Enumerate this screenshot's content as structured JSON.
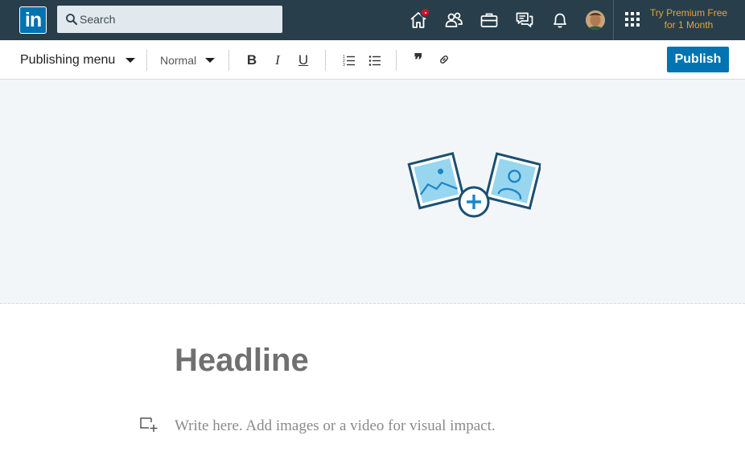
{
  "topnav": {
    "logo_text": "in",
    "search": {
      "placeholder": "Search",
      "value": ""
    },
    "icons": [
      "home-icon",
      "my-network-icon",
      "jobs-icon",
      "messaging-icon",
      "notifications-icon",
      "profile-avatar",
      "work-grid-icon"
    ],
    "home_badge": true,
    "premium_line1": "Try Premium Free",
    "premium_line2": "for 1 Month",
    "premium_color": "#e7a33e",
    "bg_color": "#283e4a"
  },
  "toolbar": {
    "publishing_menu_label": "Publishing menu",
    "style_select": "Normal",
    "bold_label": "B",
    "italic_label": "I",
    "underline_label": "U",
    "quote_label": "❞",
    "publish_label": "Publish",
    "accent_color": "#0073b1"
  },
  "cover": {
    "illustration": "add-cover-image-icon",
    "bg_color": "#f3f6f8"
  },
  "editor": {
    "headline_placeholder": "Headline",
    "body_placeholder": "Write here. Add images or a video for visual impact.",
    "add_media_icon": "add-media-icon"
  }
}
